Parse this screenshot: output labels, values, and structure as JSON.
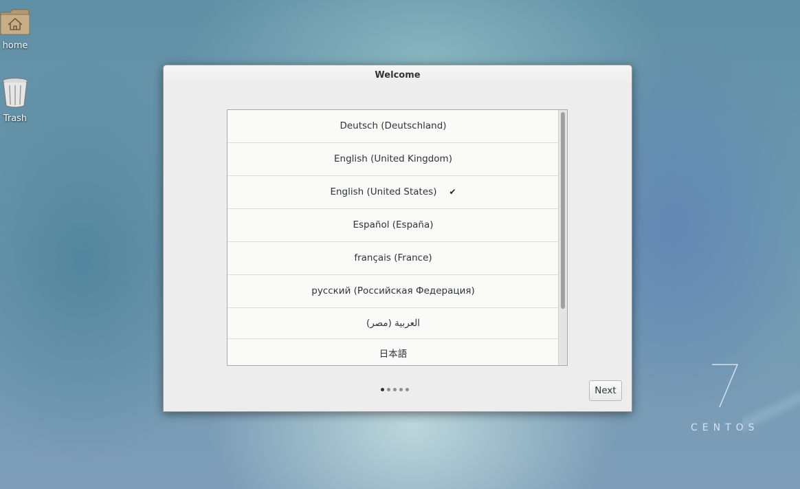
{
  "desktop": {
    "icons": [
      {
        "label": "home"
      },
      {
        "label": "Trash"
      }
    ],
    "brand": {
      "number": "7",
      "name": "CENTOS"
    }
  },
  "window": {
    "title": "Welcome",
    "languages": [
      {
        "label": "Deutsch (Deutschland)",
        "selected": false
      },
      {
        "label": "English (United Kingdom)",
        "selected": false
      },
      {
        "label": "English (United States)",
        "selected": true
      },
      {
        "label": "Español (España)",
        "selected": false
      },
      {
        "label": "français (France)",
        "selected": false
      },
      {
        "label": "русский (Российская Федерация)",
        "selected": false
      },
      {
        "label": "العربية (مصر)",
        "selected": false
      },
      {
        "label": "日本語",
        "selected": false
      }
    ],
    "check_glyph": "✔",
    "pager": {
      "current_page": 1,
      "total_pages": 5
    },
    "next_label": "Next"
  }
}
